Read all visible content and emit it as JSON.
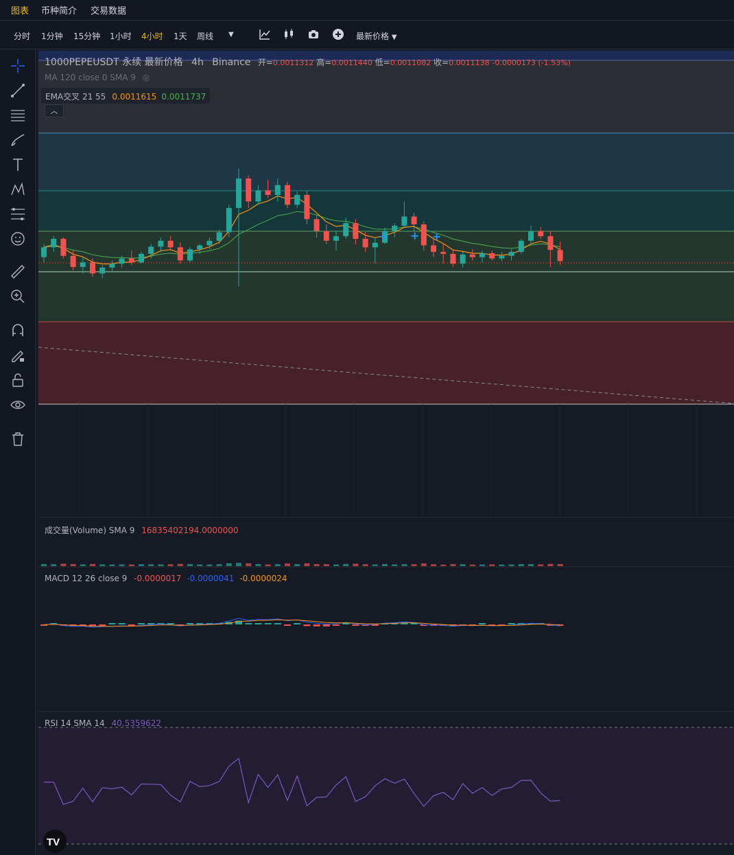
{
  "top_tabs": {
    "chart": "图表",
    "info": "币种简介",
    "trading_data": "交易数据"
  },
  "toolbar": {
    "intervals": [
      "分时",
      "1分钟",
      "15分钟",
      "1小时",
      "4小时",
      "1天",
      "周线"
    ],
    "active_interval": "4小时",
    "price_type": "最新价格"
  },
  "legend": {
    "symbol": "1000PEPEUSDT 永续 最新价格",
    "interval": "4h",
    "exchange": "Binance",
    "open_label": "开=",
    "open": "0.0011312",
    "high_label": "高=",
    "high": "0.0011440",
    "low_label": "低=",
    "low": "0.0011082",
    "close_label": "收=",
    "close": "0.0011138",
    "change": "-0.0000173 (-1.53%)",
    "ma_line": "MA 120 close 0 SMA 9",
    "ema_label": "EMA交叉 21 55",
    "ema_fast": "0.0011615",
    "ema_slow": "0.0011737",
    "volume_label": "成交量(Volume) SMA 9",
    "volume_value": "16835402194.0000000",
    "macd_label": "MACD 12 26 close 9",
    "macd_hist": "-0.0000017",
    "macd_line": "-0.0000041",
    "macd_signal": "-0.0000024",
    "rsi_label": "RSI 14 SMA 14",
    "rsi_value": "40.5359622"
  },
  "colors": {
    "up": "#26a69a",
    "down": "#ef5350",
    "ema_fast": "#f7931a",
    "ema_slow": "#4caf50",
    "accent": "#f0b90b",
    "rsi": "#7e57c2"
  },
  "chart_data": {
    "type": "candlestick",
    "timeframe": "4h",
    "candles_ohlc_approx": [
      [
        0.00112,
        0.00114,
        0.001112,
        0.001135
      ],
      [
        0.001135,
        0.001152,
        0.001128,
        0.001148
      ],
      [
        0.001148,
        0.00115,
        0.001118,
        0.001122
      ],
      [
        0.001122,
        0.00113,
        0.0011,
        0.001105
      ],
      [
        0.001105,
        0.00112,
        0.001095,
        0.001112
      ],
      [
        0.001112,
        0.001118,
        0.00109,
        0.001095
      ],
      [
        0.001095,
        0.001108,
        0.001088,
        0.001104
      ],
      [
        0.001104,
        0.001115,
        0.001096,
        0.00111
      ],
      [
        0.00111,
        0.001122,
        0.001104,
        0.001118
      ],
      [
        0.001118,
        0.00113,
        0.001108,
        0.001112
      ],
      [
        0.001112,
        0.001128,
        0.00111,
        0.001125
      ],
      [
        0.001125,
        0.00114,
        0.001118,
        0.001136
      ],
      [
        0.001136,
        0.00115,
        0.001128,
        0.001145
      ],
      [
        0.001145,
        0.001152,
        0.00113,
        0.001135
      ],
      [
        0.001135,
        0.001142,
        0.00111,
        0.001115
      ],
      [
        0.001115,
        0.001135,
        0.001112,
        0.001132
      ],
      [
        0.001132,
        0.00114,
        0.001125,
        0.001138
      ],
      [
        0.001138,
        0.00115,
        0.001132,
        0.001145
      ],
      [
        0.001145,
        0.001162,
        0.00114,
        0.001158
      ],
      [
        0.001158,
        0.0012,
        0.00115,
        0.001195
      ],
      [
        0.001195,
        0.001255,
        0.001075,
        0.00124
      ],
      [
        0.00124,
        0.001245,
        0.001195,
        0.001205
      ],
      [
        0.001205,
        0.00123,
        0.0012,
        0.001222
      ],
      [
        0.001222,
        0.001238,
        0.00121,
        0.001215
      ],
      [
        0.001215,
        0.00124,
        0.001205,
        0.00123
      ],
      [
        0.00123,
        0.001235,
        0.001195,
        0.0012
      ],
      [
        0.0012,
        0.00122,
        0.001195,
        0.001215
      ],
      [
        0.001215,
        0.001222,
        0.00117,
        0.001178
      ],
      [
        0.001178,
        0.001185,
        0.00115,
        0.00116
      ],
      [
        0.00116,
        0.00117,
        0.00114,
        0.001145
      ],
      [
        0.001145,
        0.00116,
        0.00113,
        0.001152
      ],
      [
        0.001152,
        0.00118,
        0.001148,
        0.001172
      ],
      [
        0.001172,
        0.001178,
        0.00114,
        0.001148
      ],
      [
        0.001148,
        0.001158,
        0.001128,
        0.001135
      ],
      [
        0.001135,
        0.00115,
        0.00111,
        0.001142
      ],
      [
        0.001142,
        0.001165,
        0.00114,
        0.00116
      ],
      [
        0.00116,
        0.001172,
        0.00115,
        0.001168
      ],
      [
        0.001168,
        0.001205,
        0.001165,
        0.001182
      ],
      [
        0.001182,
        0.001188,
        0.00116,
        0.00117
      ],
      [
        0.00117,
        0.001175,
        0.00113,
        0.001138
      ],
      [
        0.001138,
        0.001148,
        0.00112,
        0.001128
      ],
      [
        0.001128,
        0.00114,
        0.00111,
        0.001125
      ],
      [
        0.001125,
        0.001132,
        0.001105,
        0.00111
      ],
      [
        0.00111,
        0.001128,
        0.001104,
        0.001124
      ],
      [
        0.001124,
        0.001132,
        0.001115,
        0.00112
      ],
      [
        0.00112,
        0.00113,
        0.001112,
        0.001126
      ],
      [
        0.001126,
        0.00113,
        0.001115,
        0.001118
      ],
      [
        0.001118,
        0.001128,
        0.001114,
        0.001122
      ],
      [
        0.001122,
        0.001132,
        0.001115,
        0.001128
      ],
      [
        0.001128,
        0.001148,
        0.001125,
        0.001145
      ],
      [
        0.001145,
        0.001168,
        0.00114,
        0.00116
      ],
      [
        0.00116,
        0.001166,
        0.001148,
        0.001152
      ],
      [
        0.001152,
        0.00116,
        0.001105,
        0.001131
      ],
      [
        0.001131,
        0.001144,
        0.001108,
        0.001114
      ]
    ],
    "price_line": 0.0011138
  }
}
